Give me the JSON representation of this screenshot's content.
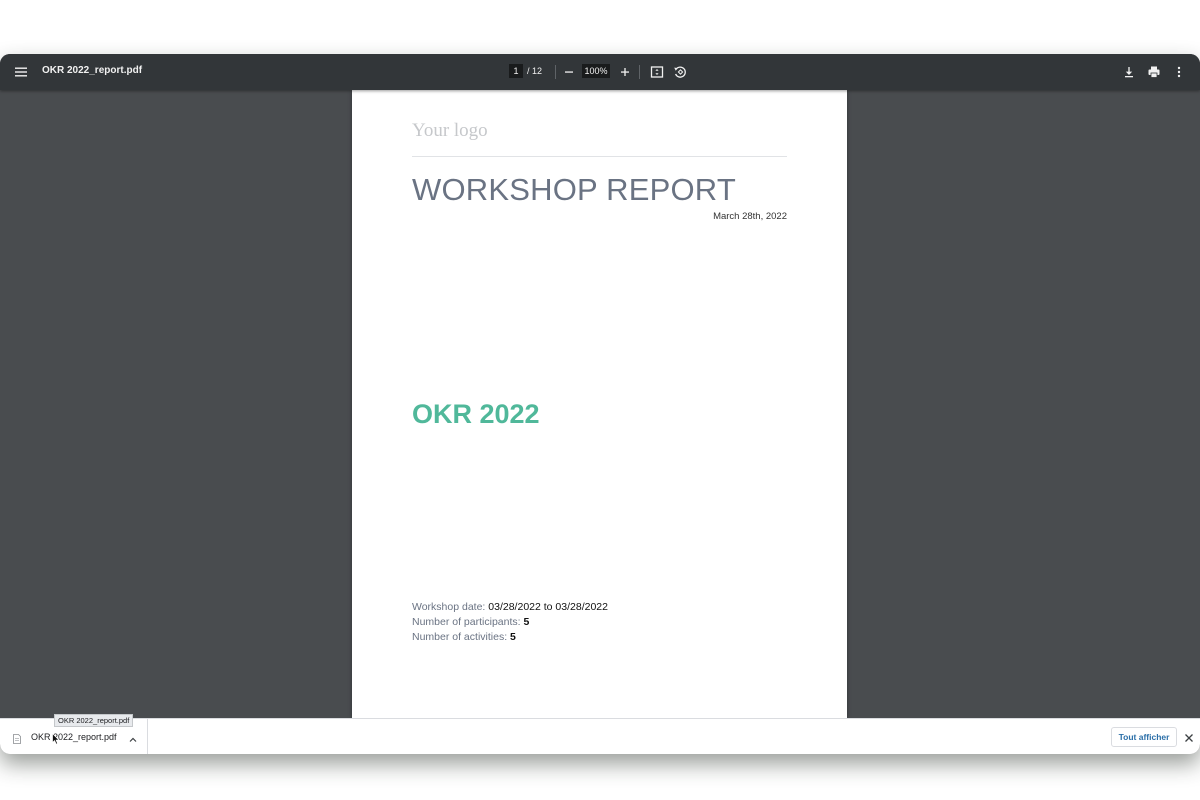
{
  "toolbar": {
    "menu_icon": "hamburger-menu-icon",
    "title": "OKR 2022_report.pdf",
    "page_current": "1",
    "page_total": "/ 12",
    "zoom_out_icon": "minus-icon",
    "zoom_level": "100%",
    "zoom_in_icon": "plus-icon",
    "fit_page_icon": "fit-to-page-icon",
    "rotate_icon": "rotate-counterclockwise-icon",
    "download_icon": "download-icon",
    "print_icon": "print-icon",
    "more_icon": "more-vert-icon"
  },
  "document": {
    "logo_text": "Your logo",
    "heading": "WORKSHOP REPORT",
    "date": "March 28th, 2022",
    "title": "OKR 2022",
    "details": {
      "workshop_date_label": "Workshop date:",
      "workshop_date_value": "03/28/2022 to 03/28/2022",
      "participants_label": "Number of participants:",
      "participants_value": "5",
      "activities_label": "Number of activities:",
      "activities_value": "5"
    }
  },
  "download_bar": {
    "file_icon": "pdf-file-icon",
    "file_name": "OKR 2022_report.pdf",
    "tooltip": "OKR 2022_report.pdf",
    "chevron_icon": "chevron-up-icon",
    "show_all_label": "Tout afficher",
    "close_icon": "close-icon"
  },
  "colors": {
    "toolbar_bg": "#323639",
    "viewer_bg": "#494c4f",
    "heading_gray": "#6a7383",
    "okr_green": "#50b89a"
  }
}
